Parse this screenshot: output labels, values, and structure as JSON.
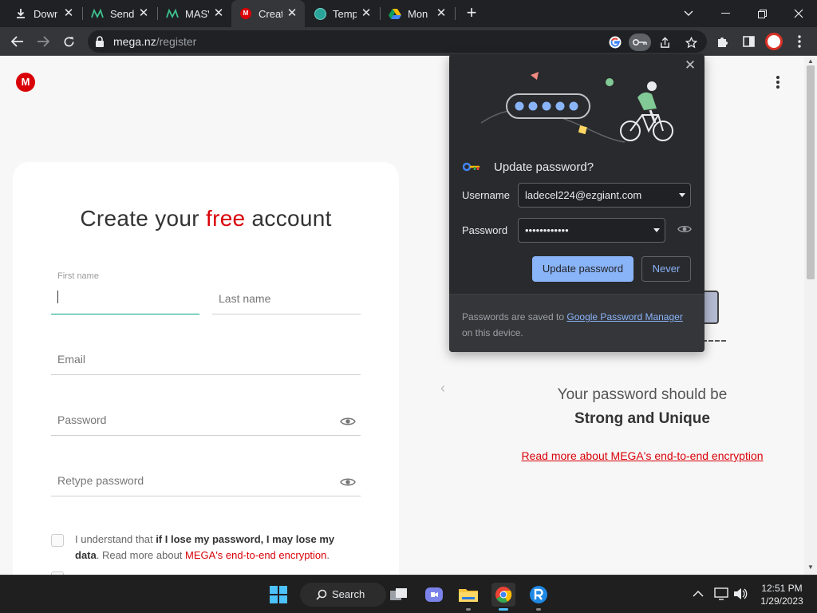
{
  "browser": {
    "tabs": [
      {
        "title": "Downloads",
        "icon": "download-icon"
      },
      {
        "title": "SendGrid",
        "icon": "maildrop-icon"
      },
      {
        "title": "MASV",
        "icon": "masv-icon"
      },
      {
        "title": "Create your free account",
        "icon": "mega-icon"
      },
      {
        "title": "Temp Mail",
        "icon": "temp-mail-icon"
      },
      {
        "title": "Mon",
        "icon": "google-drive-icon"
      }
    ],
    "active_tab_index": 3,
    "url_host": "mega.nz",
    "url_path": "/register"
  },
  "page": {
    "title_prefix": "Create your ",
    "title_accent": "free",
    "title_suffix": " account",
    "first_name_label": "First name",
    "last_name_placeholder": "Last name",
    "email_placeholder": "Email",
    "password_placeholder": "Password",
    "retype_placeholder": "Retype password",
    "terms_prefix": "I understand that ",
    "terms_bold": "if I lose my password, I may lose my",
    "terms_mid": "data",
    "terms_after": ". Read more about ",
    "terms_link": "MEGA's end-to-end encryption",
    "terms_end": ".",
    "side_line1": "Your password should be",
    "side_line2": "Strong and Unique",
    "side_link": "Read more about MEGA's end-to-end encryption"
  },
  "password_bubble": {
    "title": "Update password?",
    "username_label": "Username",
    "username_value": "ladecel224@ezgiant.com",
    "password_label": "Password",
    "password_value": "••••••••••••",
    "update_button": "Update password",
    "never_button": "Never",
    "footer_prefix": "Passwords are saved to ",
    "footer_link": "Google Password Manager",
    "footer_suffix": " on this device."
  },
  "taskbar": {
    "search_label": "Search",
    "time": "12:51 PM",
    "date": "1/29/2023"
  },
  "colors": {
    "mega_red": "#d90007",
    "chrome_dark": "#202124",
    "accent_blue": "#8ab4f8"
  }
}
